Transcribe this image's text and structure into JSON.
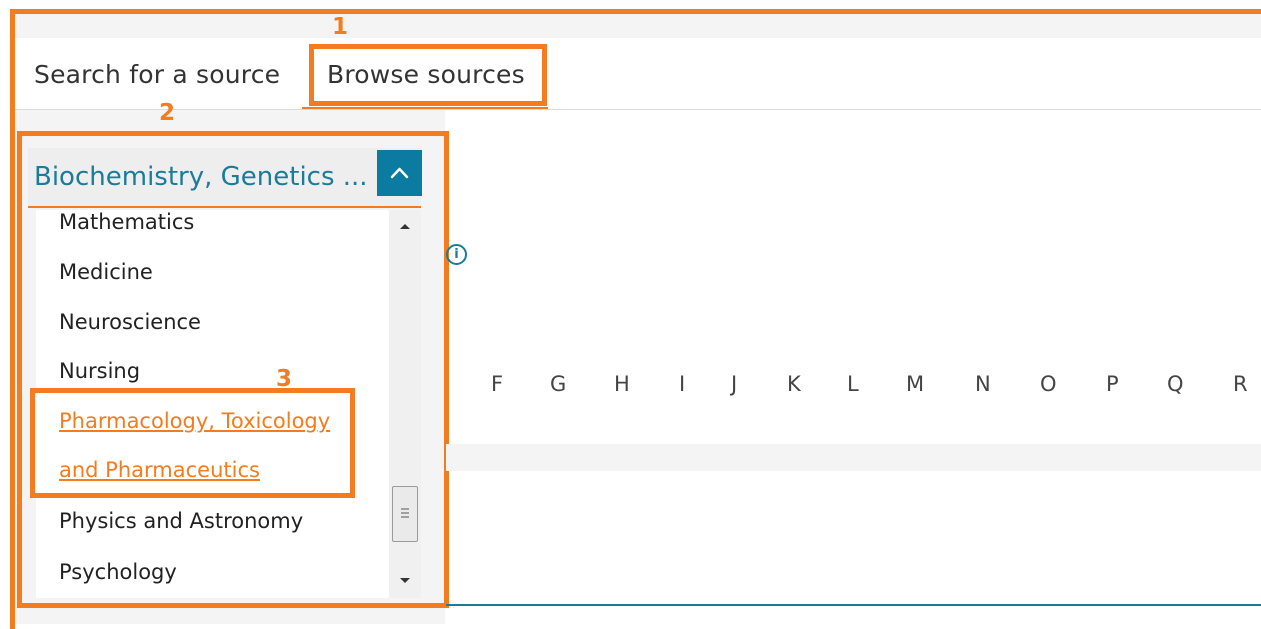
{
  "tabs": {
    "search_label": "Search for a source",
    "browse_label": "Browse sources"
  },
  "annotations": [
    "1",
    "2",
    "3"
  ],
  "dropdown": {
    "selected": "Biochemistry, Genetics ...",
    "toggle_icon": "chevron-up-icon",
    "items": [
      "Mathematics",
      "Medicine",
      "Neuroscience",
      "Nursing",
      "Pharmacology, Toxicology",
      "and Pharmaceutics",
      "Physics and Astronomy",
      "Psychology"
    ],
    "highlighted_item": "Pharmacology, Toxicology and Pharmaceutics"
  },
  "alphabet": [
    "F",
    "G",
    "H",
    "I",
    "J",
    "K",
    "L",
    "M",
    "N",
    "O",
    "P",
    "Q",
    "R"
  ],
  "colors": {
    "accent_orange": "#f47c20",
    "link_teal": "#1a7b9a",
    "button_blue": "#0c7ba2"
  }
}
